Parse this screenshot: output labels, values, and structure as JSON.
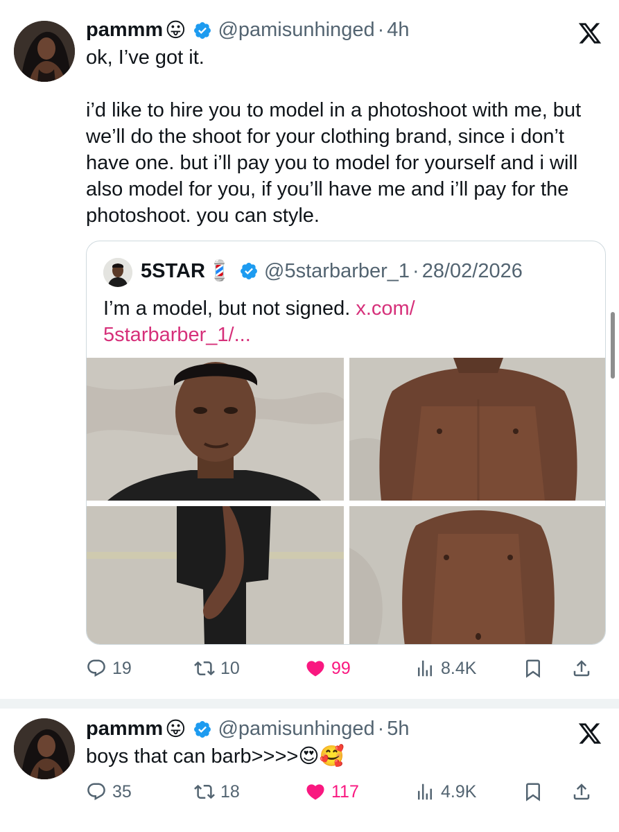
{
  "tweets": [
    {
      "author": {
        "name": "pammm",
        "name_emoji": "😛",
        "handle": "@pamisunhinged",
        "time": "4h",
        "separator": "·"
      },
      "text": "ok, I’ve got it.\n\ni’d like to hire you to model in a photoshoot with me, but we’ll do the shoot for your clothing brand, since i don’t have one. but i’ll pay you to model for yourself and i will also model for you, if you’ll have me and i’ll pay for the photoshoot. you can style.",
      "quote": {
        "author": {
          "name": "5STAR",
          "name_emoji": "💈",
          "handle": "@5starbarber_1",
          "date": "28/02/2026",
          "separator": "·"
        },
        "text": "I’m a model, but not signed.",
        "link_text": "x.com/\n5starbarber_1/..."
      },
      "stats": {
        "replies": "19",
        "reposts": "10",
        "likes": "99",
        "views": "8.4K"
      }
    },
    {
      "author": {
        "name": "pammm",
        "name_emoji": "😛",
        "handle": "@pamisunhinged",
        "time": "5h",
        "separator": "·"
      },
      "text": "boys that can barb>>>>😍🥰",
      "stats": {
        "replies": "35",
        "reposts": "18",
        "likes": "117",
        "views": "4.9K"
      }
    }
  ],
  "colors": {
    "verified": "#1d9bf0",
    "like": "#f91880",
    "link": "#d6307a",
    "secondary_text": "#536471",
    "border": "#cfd9de"
  },
  "icons": [
    "verified-badge-icon",
    "x-logo-icon",
    "reply-icon",
    "repost-icon",
    "heart-icon",
    "views-icon",
    "bookmark-icon",
    "share-icon"
  ]
}
